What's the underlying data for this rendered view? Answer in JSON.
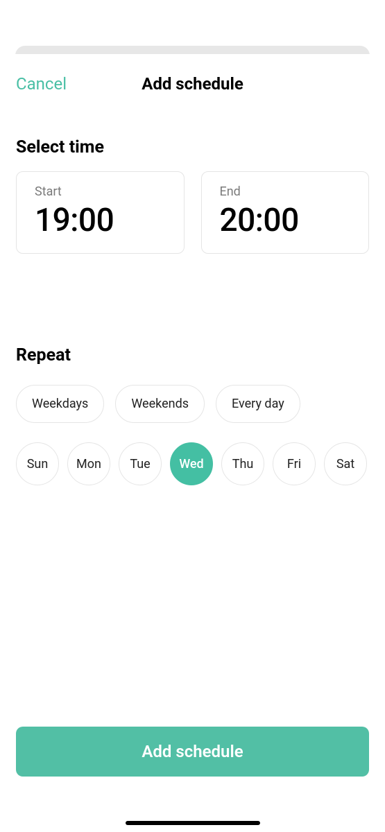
{
  "header": {
    "cancel": "Cancel",
    "title": "Add schedule"
  },
  "time": {
    "section_label": "Select time",
    "start_label": "Start",
    "start_value": "19:00",
    "end_label": "End",
    "end_value": "20:00"
  },
  "repeat": {
    "section_label": "Repeat",
    "presets": [
      {
        "label": "Weekdays"
      },
      {
        "label": "Weekends"
      },
      {
        "label": "Every day"
      }
    ],
    "days": [
      {
        "label": "Sun",
        "selected": false
      },
      {
        "label": "Mon",
        "selected": false
      },
      {
        "label": "Tue",
        "selected": false
      },
      {
        "label": "Wed",
        "selected": true
      },
      {
        "label": "Thu",
        "selected": false
      },
      {
        "label": "Fri",
        "selected": false
      },
      {
        "label": "Sat",
        "selected": false
      }
    ]
  },
  "submit": {
    "label": "Add schedule"
  }
}
